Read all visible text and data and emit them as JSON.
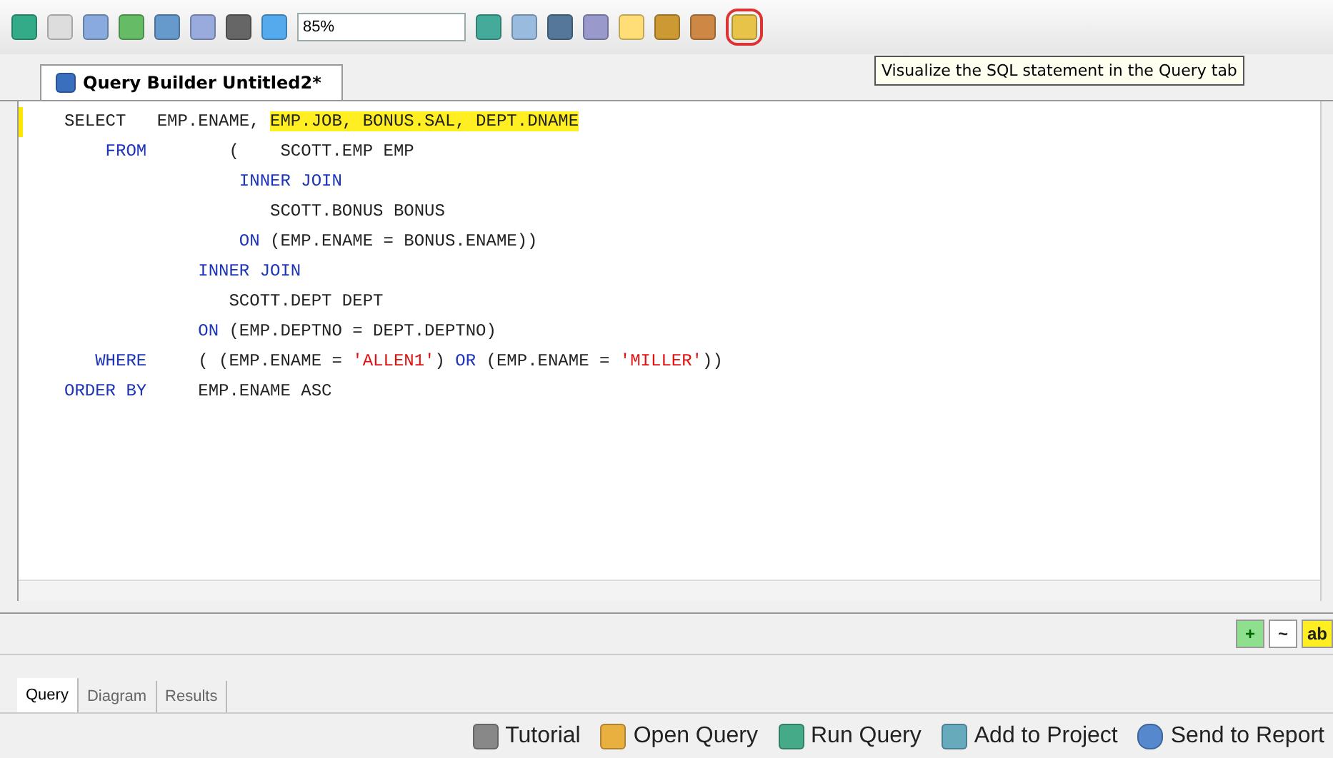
{
  "toolbar": {
    "zoom": "85%",
    "visualize_highlighted": true,
    "tooltip": "Visualize the SQL statement in the Query tab"
  },
  "document_tab": {
    "title": "Query Builder Untitled2*"
  },
  "editor": {
    "lines": [
      [
        {
          "text": "SELECT   ",
          "kind": "plain",
          "highlight": false
        },
        {
          "text": "EMP.ENAME, ",
          "kind": "plain",
          "highlight": false
        },
        {
          "text": "EMP.JOB, BONUS.SAL,",
          "kind": "plain",
          "highlight": true
        },
        {
          "text": " DEPT.DNAME",
          "kind": "plain",
          "highlight": true
        }
      ],
      [
        {
          "text": "    FROM",
          "kind": "keyword",
          "highlight": false
        },
        {
          "text": "        (    SCOTT.EMP EMP",
          "kind": "plain",
          "highlight": false
        }
      ],
      [
        {
          "text": "                 INNER JOIN",
          "kind": "keyword",
          "highlight": false
        }
      ],
      [
        {
          "text": "                    SCOTT.BONUS BONUS",
          "kind": "plain",
          "highlight": false
        }
      ],
      [
        {
          "text": "                 ON",
          "kind": "keyword",
          "highlight": false
        },
        {
          "text": " (EMP.ENAME = BONUS.ENAME))",
          "kind": "plain",
          "highlight": false
        }
      ],
      [
        {
          "text": "             INNER JOIN",
          "kind": "keyword",
          "highlight": false
        }
      ],
      [
        {
          "text": "                SCOTT.DEPT DEPT",
          "kind": "plain",
          "highlight": false
        }
      ],
      [
        {
          "text": "             ON",
          "kind": "keyword",
          "highlight": false
        },
        {
          "text": " (EMP.DEPTNO = DEPT.DEPTNO)",
          "kind": "plain",
          "highlight": false
        }
      ],
      [
        {
          "text": "   WHERE",
          "kind": "keyword",
          "highlight": false
        },
        {
          "text": "     ( (EMP.ENAME = ",
          "kind": "plain",
          "highlight": false
        },
        {
          "text": "'ALLEN1'",
          "kind": "string",
          "highlight": false
        },
        {
          "text": ") ",
          "kind": "plain",
          "highlight": false
        },
        {
          "text": "OR",
          "kind": "keyword",
          "highlight": false
        },
        {
          "text": " (EMP.ENAME = ",
          "kind": "plain",
          "highlight": false
        },
        {
          "text": "'MILLER'",
          "kind": "string",
          "highlight": false
        },
        {
          "text": "))",
          "kind": "plain",
          "highlight": false
        }
      ],
      [
        {
          "text": "ORDER BY",
          "kind": "keyword",
          "highlight": false
        },
        {
          "text": "     EMP.ENAME ASC",
          "kind": "plain",
          "highlight": false
        }
      ]
    ]
  },
  "format_buttons": [
    "+",
    "~",
    "ab"
  ],
  "view_tabs": [
    {
      "label": "Query",
      "selected": true
    },
    {
      "label": "Diagram",
      "selected": false
    },
    {
      "label": "Results",
      "selected": false
    }
  ],
  "actions": [
    "Tutorial",
    "Open Query",
    "Run Query",
    "Add to Project",
    "Send to Report"
  ]
}
